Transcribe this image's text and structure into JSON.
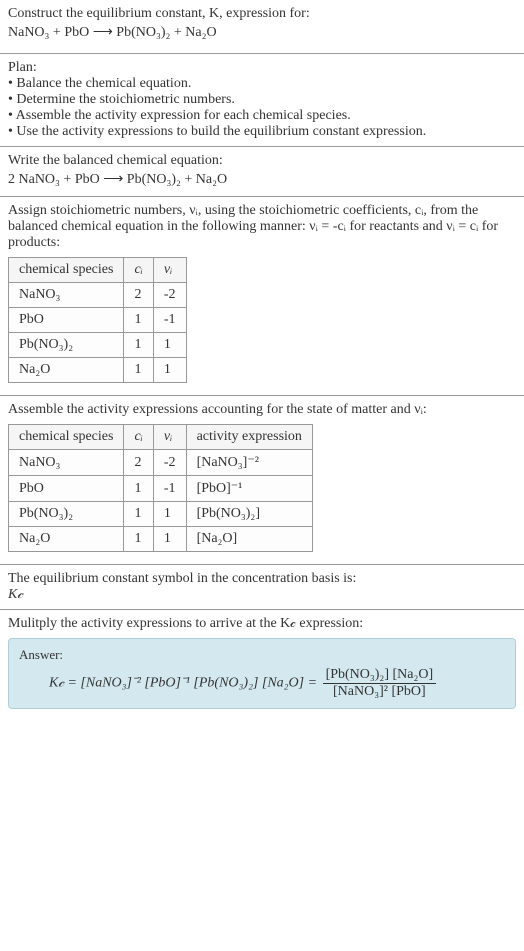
{
  "intro": {
    "line1": "Construct the equilibrium constant, K, expression for:",
    "eq": "NaNO₃ + PbO ⟶ Pb(NO₃)₂ + Na₂O"
  },
  "plan": {
    "heading": "Plan:",
    "b1": "• Balance the chemical equation.",
    "b2": "• Determine the stoichiometric numbers.",
    "b3": "• Assemble the activity expression for each chemical species.",
    "b4": "• Use the activity expressions to build the equilibrium constant expression."
  },
  "balanced": {
    "heading": "Write the balanced chemical equation:",
    "eq": "2 NaNO₃ + PbO ⟶ Pb(NO₃)₂ + Na₂O"
  },
  "stoich": {
    "heading_a": "Assign stoichiometric numbers, νᵢ, using the stoichiometric coefficients, cᵢ, from the balanced chemical equation in the following manner: νᵢ = -cᵢ for reactants and νᵢ = cᵢ for products:",
    "headers": {
      "h1": "chemical species",
      "h2": "cᵢ",
      "h3": "νᵢ"
    },
    "rows": [
      {
        "sp": "NaNO₃",
        "c": "2",
        "v": "-2"
      },
      {
        "sp": "PbO",
        "c": "1",
        "v": "-1"
      },
      {
        "sp": "Pb(NO₃)₂",
        "c": "1",
        "v": "1"
      },
      {
        "sp": "Na₂O",
        "c": "1",
        "v": "1"
      }
    ]
  },
  "activity": {
    "heading": "Assemble the activity expressions accounting for the state of matter and νᵢ:",
    "headers": {
      "h1": "chemical species",
      "h2": "cᵢ",
      "h3": "νᵢ",
      "h4": "activity expression"
    },
    "rows": [
      {
        "sp": "NaNO₃",
        "c": "2",
        "v": "-2",
        "a": "[NaNO₃]⁻²"
      },
      {
        "sp": "PbO",
        "c": "1",
        "v": "-1",
        "a": "[PbO]⁻¹"
      },
      {
        "sp": "Pb(NO₃)₂",
        "c": "1",
        "v": "1",
        "a": "[Pb(NO₃)₂]"
      },
      {
        "sp": "Na₂O",
        "c": "1",
        "v": "1",
        "a": "[Na₂O]"
      }
    ]
  },
  "symbol": {
    "heading": "The equilibrium constant symbol in the concentration basis is:",
    "val": "K𝒸"
  },
  "multiply": {
    "heading": "Mulitply the activity expressions to arrive at the K𝒸 expression:"
  },
  "answer": {
    "label": "Answer:",
    "lhs": "K𝒸 = [NaNO₃]⁻² [PbO]⁻¹ [Pb(NO₃)₂] [Na₂O] = ",
    "num": "[Pb(NO₃)₂] [Na₂O]",
    "den": "[NaNO₃]² [PbO]"
  },
  "chart_data": {
    "type": "table",
    "tables": [
      {
        "title": "stoichiometric numbers",
        "columns": [
          "chemical species",
          "c_i",
          "v_i"
        ],
        "rows": [
          [
            "NaNO3",
            2,
            -2
          ],
          [
            "PbO",
            1,
            -1
          ],
          [
            "Pb(NO3)2",
            1,
            1
          ],
          [
            "Na2O",
            1,
            1
          ]
        ]
      },
      {
        "title": "activity expressions",
        "columns": [
          "chemical species",
          "c_i",
          "v_i",
          "activity expression"
        ],
        "rows": [
          [
            "NaNO3",
            2,
            -2,
            "[NaNO3]^-2"
          ],
          [
            "PbO",
            1,
            -1,
            "[PbO]^-1"
          ],
          [
            "Pb(NO3)2",
            1,
            1,
            "[Pb(NO3)2]"
          ],
          [
            "Na2O",
            1,
            1,
            "[Na2O]"
          ]
        ]
      }
    ]
  }
}
